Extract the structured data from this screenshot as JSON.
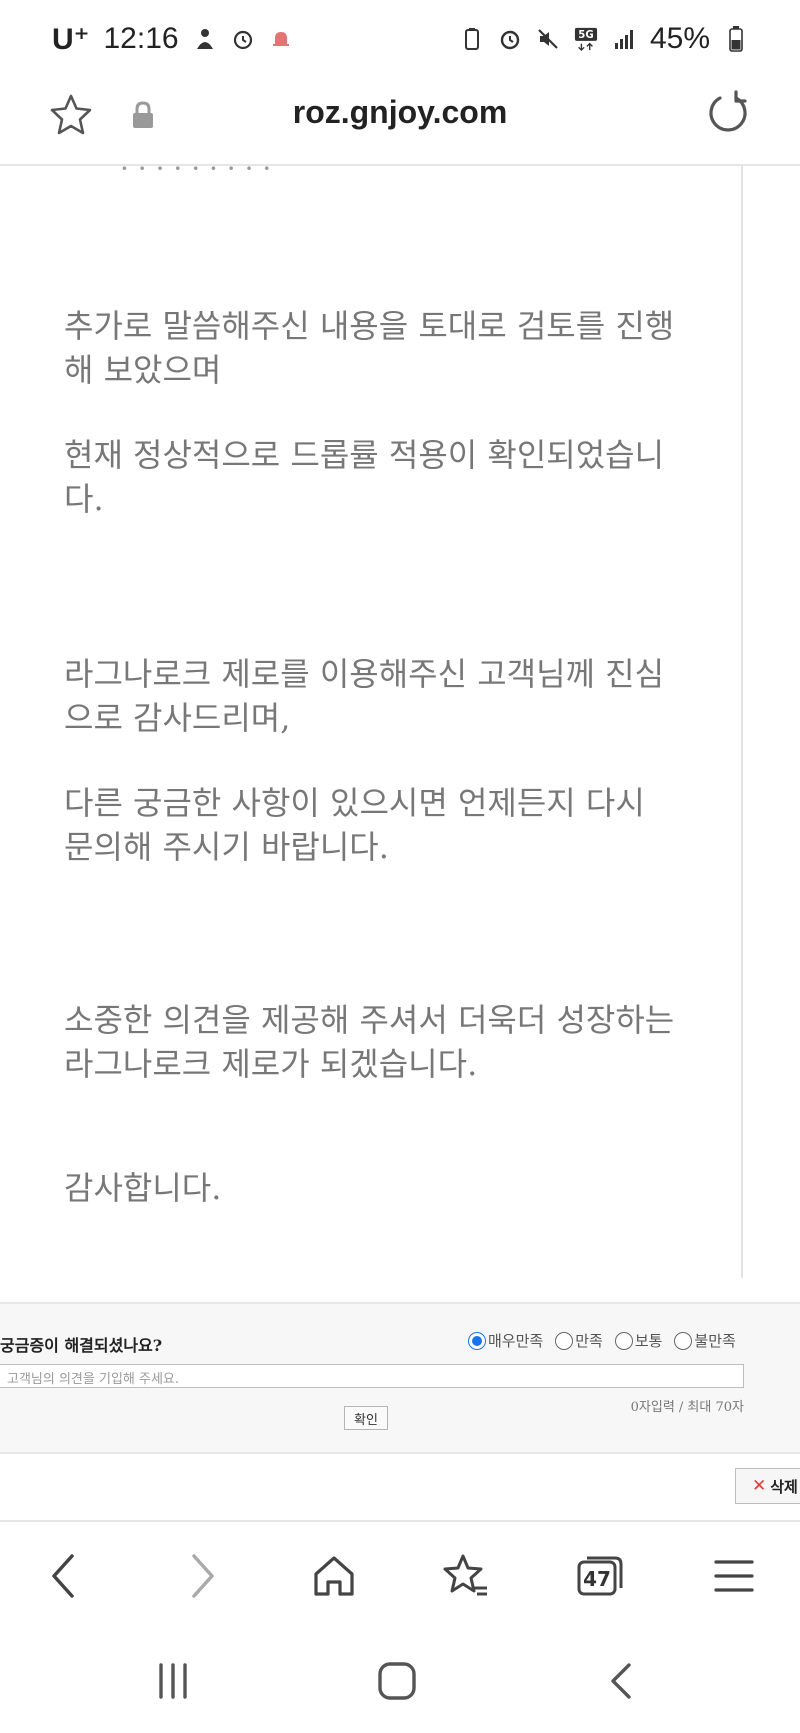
{
  "status_bar": {
    "carrier": "U⁺",
    "time": "12:16",
    "network": "5G",
    "battery": "45%"
  },
  "address_bar": {
    "url": "roz.gnjoy.com"
  },
  "content": {
    "cut_text": "· · · · · · · · ·",
    "paragraphs": [
      "추가로 말씀해주신 내용을 토대로 검토를 진행해 보았으며",
      "현재 정상적으로 드롭률 적용이 확인되었습니다.",
      "라그나로크 제로를 이용해주신 고객님께 진심으로 감사드리며,",
      "다른 궁금한 사항이 있으시면 언제든지 다시 문의해 주시기 바랍니다.",
      "소중한 의견을 제공해 주셔서 더욱더 성장하는 라그나로크 제로가 되겠습니다.",
      "감사합니다."
    ]
  },
  "feedback": {
    "question": "궁금증이 해결되셨나요?",
    "options": [
      "매우만족",
      "만족",
      "보통",
      "불만족"
    ],
    "selected": "매우만족",
    "input_placeholder": "고객님의 의견을 기입해 주세요.",
    "char_count": "0자입력 / 최대 70자",
    "submit_label": "확인"
  },
  "delete_label": "삭제",
  "browser_nav": {
    "tab_count": "47"
  },
  "colors": {
    "accent": "#1a73e8",
    "delete_x": "#e53935",
    "body_text": "#777777"
  }
}
